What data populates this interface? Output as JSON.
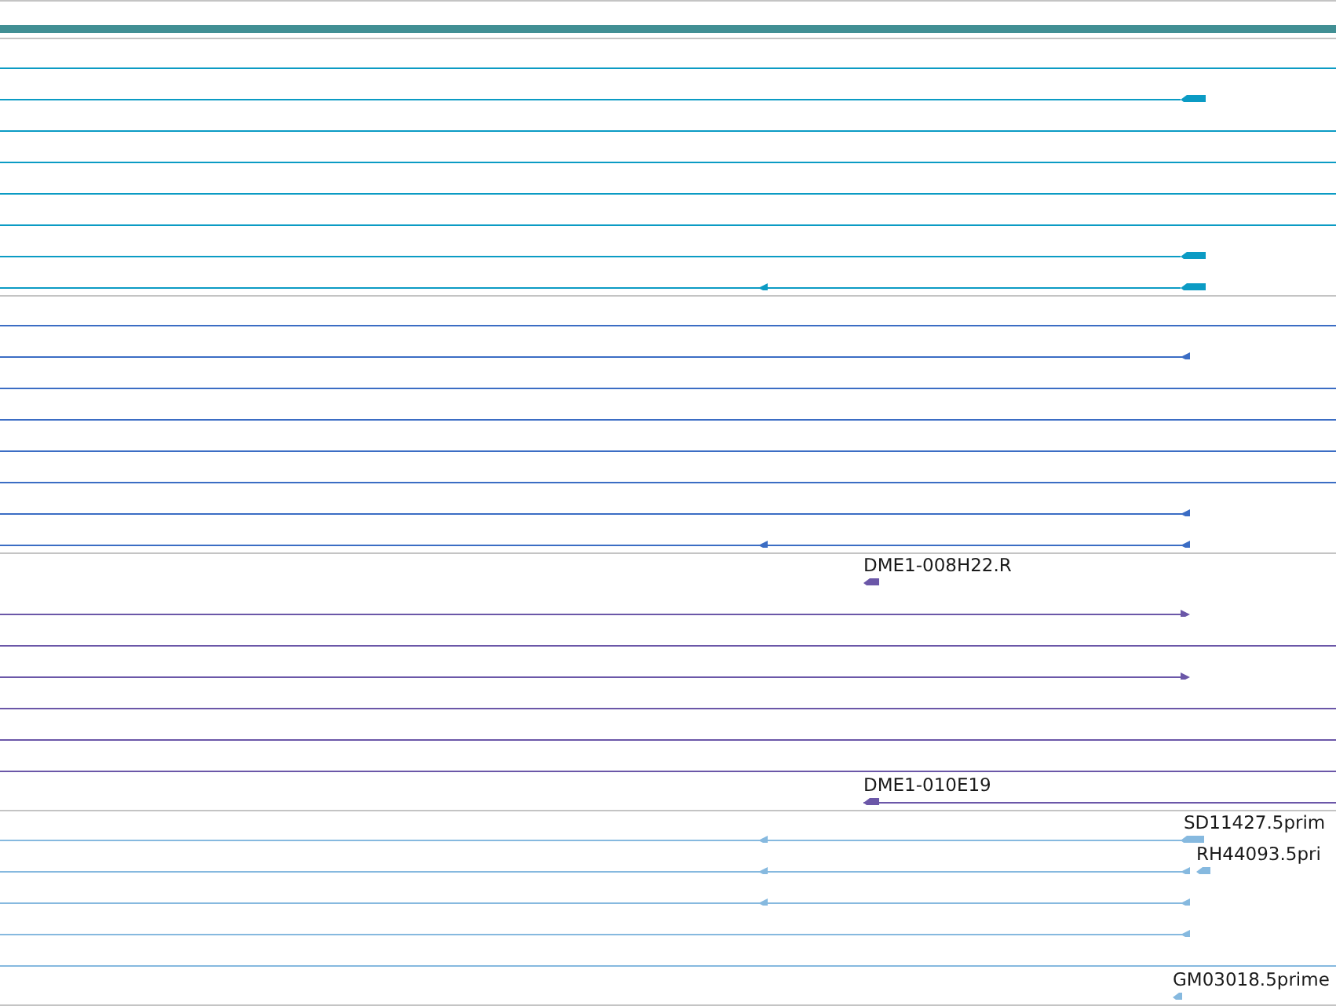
{
  "tracks": [
    {
      "color": "#418f94",
      "features": [
        {
          "kind": "bar"
        }
      ]
    },
    {
      "color": "#0b9bc4",
      "features": [
        {
          "kind": "line"
        },
        {
          "kind": "line",
          "reverse": true
        },
        {
          "kind": "line"
        },
        {
          "kind": "line"
        },
        {
          "kind": "line"
        },
        {
          "kind": "line"
        },
        {
          "kind": "line",
          "reverse": true
        },
        {
          "kind": "line",
          "reverse": true
        }
      ]
    },
    {
      "color": "#3b6dc4",
      "features": [
        {
          "kind": "line"
        },
        {
          "kind": "line",
          "reverse": true
        },
        {
          "kind": "line"
        },
        {
          "kind": "line"
        },
        {
          "kind": "line"
        },
        {
          "kind": "line"
        },
        {
          "kind": "line",
          "reverse": true
        },
        {
          "kind": "line",
          "reverse": true
        }
      ]
    },
    {
      "color": "#6b57a8",
      "features": [
        {
          "kind": "block",
          "reverse": true,
          "label": "DME1-008H22.R"
        },
        {
          "kind": "line",
          "reverse": false
        },
        {
          "kind": "line"
        },
        {
          "kind": "line",
          "reverse": false
        },
        {
          "kind": "line"
        },
        {
          "kind": "line"
        },
        {
          "kind": "line"
        },
        {
          "kind": "line",
          "reverse": true,
          "label": "DME1-010E19"
        }
      ]
    },
    {
      "color": "#86b9df",
      "features": [
        {
          "kind": "line",
          "reverse": true,
          "label": "SD11427.5prim"
        },
        {
          "kind": "line",
          "reverse": true,
          "label": "RH44093.5pri"
        },
        {
          "kind": "line",
          "reverse": true
        },
        {
          "kind": "line",
          "reverse": true
        },
        {
          "kind": "line"
        },
        {
          "kind": "block",
          "reverse": true,
          "label": "GM03018.5prime"
        }
      ]
    }
  ]
}
